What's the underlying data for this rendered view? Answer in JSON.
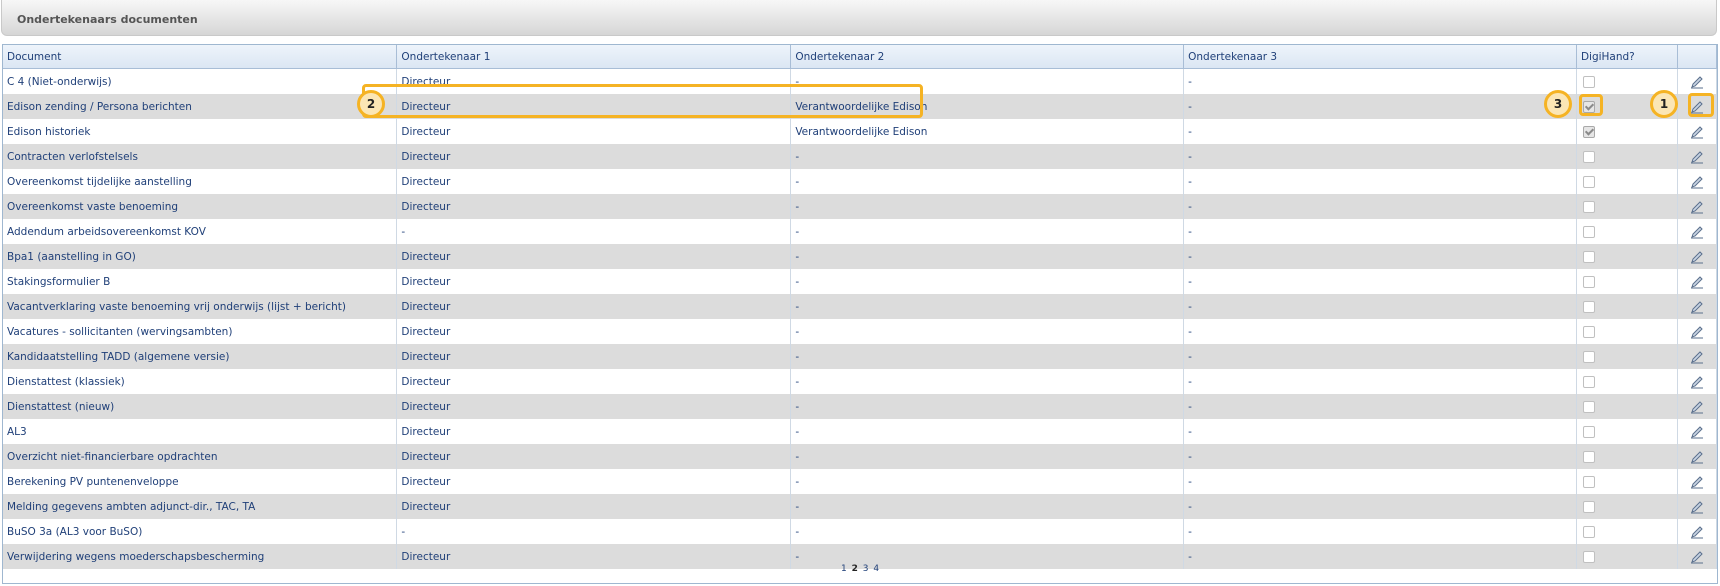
{
  "panel": {
    "title": "Ondertekenaars documenten"
  },
  "columns": [
    "Document",
    "Ondertekenaar 1",
    "Ondertekenaar 2",
    "Ondertekenaar 3",
    "DigiHand?",
    ""
  ],
  "rows": [
    {
      "doc": "C 4 (Niet-onderwijs)",
      "s1": "Directeur",
      "s2": "-",
      "s3": "-",
      "digihand": false
    },
    {
      "doc": "Edison zending / Persona berichten",
      "s1": "Directeur",
      "s2": "Verantwoordelijke Edison",
      "s3": "-",
      "digihand": true
    },
    {
      "doc": "Edison historiek",
      "s1": "Directeur",
      "s2": "Verantwoordelijke Edison",
      "s3": "-",
      "digihand": true
    },
    {
      "doc": "Contracten verlofstelsels",
      "s1": "Directeur",
      "s2": "-",
      "s3": "-",
      "digihand": false
    },
    {
      "doc": "Overeenkomst tijdelijke aanstelling",
      "s1": "Directeur",
      "s2": "-",
      "s3": "-",
      "digihand": false
    },
    {
      "doc": "Overeenkomst vaste benoeming",
      "s1": "Directeur",
      "s2": "-",
      "s3": "-",
      "digihand": false
    },
    {
      "doc": "Addendum arbeidsovereenkomst KOV",
      "s1": "-",
      "s2": "-",
      "s3": "-",
      "digihand": false
    },
    {
      "doc": "Bpa1 (aanstelling in GO)",
      "s1": "Directeur",
      "s2": "-",
      "s3": "-",
      "digihand": false
    },
    {
      "doc": "Stakingsformulier B",
      "s1": "Directeur",
      "s2": "-",
      "s3": "-",
      "digihand": false
    },
    {
      "doc": "Vacantverklaring vaste benoeming vrij onderwijs (lijst + bericht)",
      "s1": "Directeur",
      "s2": "-",
      "s3": "-",
      "digihand": false
    },
    {
      "doc": "Vacatures - sollicitanten (wervingsambten)",
      "s1": "Directeur",
      "s2": "-",
      "s3": "-",
      "digihand": false
    },
    {
      "doc": "Kandidaatstelling TADD (algemene versie)",
      "s1": "Directeur",
      "s2": "-",
      "s3": "-",
      "digihand": false
    },
    {
      "doc": "Dienstattest (klassiek)",
      "s1": "Directeur",
      "s2": "-",
      "s3": "-",
      "digihand": false
    },
    {
      "doc": "Dienstattest (nieuw)",
      "s1": "Directeur",
      "s2": "-",
      "s3": "-",
      "digihand": false
    },
    {
      "doc": "AL3",
      "s1": "Directeur",
      "s2": "-",
      "s3": "-",
      "digihand": false
    },
    {
      "doc": "Overzicht niet-financierbare opdrachten",
      "s1": "Directeur",
      "s2": "-",
      "s3": "-",
      "digihand": false
    },
    {
      "doc": "Berekening PV puntenenveloppe",
      "s1": "Directeur",
      "s2": "-",
      "s3": "-",
      "digihand": false
    },
    {
      "doc": "Melding gegevens ambten adjunct-dir., TAC, TA",
      "s1": "Directeur",
      "s2": "-",
      "s3": "-",
      "digihand": false
    },
    {
      "doc": "BuSO 3a (AL3 voor BuSO)",
      "s1": "-",
      "s2": "-",
      "s3": "-",
      "digihand": false
    },
    {
      "doc": "Verwijdering wegens moederschapsbescherming",
      "s1": "Directeur",
      "s2": "-",
      "s3": "-",
      "digihand": false
    }
  ],
  "pager": {
    "pages": [
      "1",
      "2",
      "3",
      "4"
    ],
    "current": "2"
  },
  "callouts": [
    "1",
    "2",
    "3"
  ],
  "colors": {
    "highlight": "#f5b324",
    "link": "#1f3f78"
  },
  "icons": {
    "row_action": "edit-icon"
  }
}
